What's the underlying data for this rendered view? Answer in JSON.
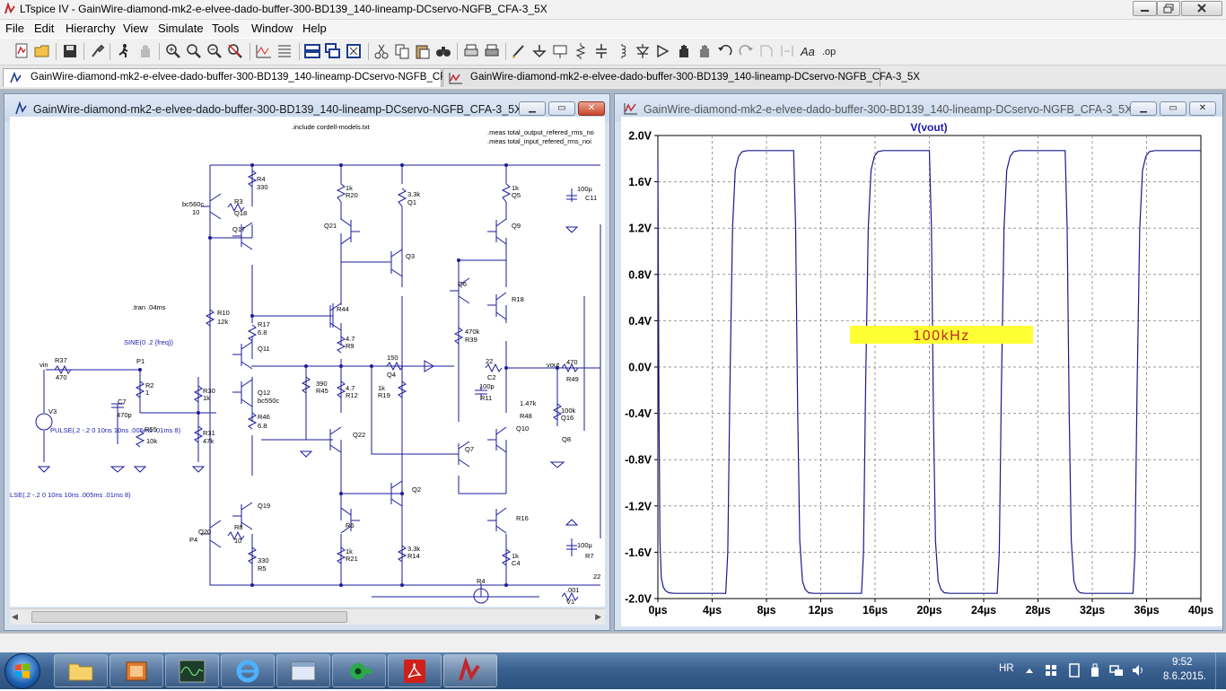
{
  "window": {
    "title": "LTspice IV - GainWire-diamond-mk2-e-elvee-dado-buffer-300-BD139_140-lineamp-DCservo-NGFB_CFA-3_5X"
  },
  "menu": [
    "File",
    "Edit",
    "Hierarchy",
    "View",
    "Simulate",
    "Tools",
    "Window",
    "Help"
  ],
  "tabs": [
    {
      "label": "GainWire-diamond-mk2-e-elvee-dado-buffer-300-BD139_140-lineamp-DCservo-NGFB_CFA-3_5X",
      "icon": "schematic-icon"
    },
    {
      "label": "GainWire-diamond-mk2-e-elvee-dado-buffer-300-BD139_140-lineamp-DCservo-NGFB_CFA-3_5X",
      "icon": "waveform-icon"
    }
  ],
  "schematic_window": {
    "title": "GainWire-diamond-mk2-e-elvee-dado-buffer-300-BD139_140-lineamp-DCservo-NGFB_CFA-3_5X",
    "directives": [
      ".include cordell-models.txt",
      ".meas total_output_refered_rms_no",
      ".meas total_input_refered_rms_noi",
      ".tran .04ms",
      "SINE(0 .2 {freq})",
      "PULSE(.2 -.2 0 10ns 10ns .005ms .01ms 8)",
      "LSE(.2 -.2 0 10ns 10ns .005ms .01ms 8)"
    ],
    "labels": [
      "vin",
      "vout",
      "P1",
      "V3",
      "R37",
      "470",
      "R2",
      "1",
      "C7",
      "470p",
      "R55",
      "10k",
      "R30",
      "1k",
      "R31",
      "47k",
      "R3",
      "10",
      "Q18",
      "bc560c",
      "Q17",
      "R4",
      "330",
      "R10",
      "12k",
      "R17",
      "6.8",
      "Q11",
      "Q12",
      "bc550c",
      "R46",
      "6.8",
      "Q19",
      "Q20",
      "R8",
      "10",
      "P4",
      "330",
      "R5",
      "1k",
      "R20",
      "3.3k",
      "Q1",
      "Q21",
      "Q3",
      "R44",
      "4.7",
      "R9",
      "390",
      "R45",
      "4.7",
      "R12",
      "1k",
      "R19",
      "150",
      "Q4",
      "Q22",
      "Q2",
      "R6",
      "1k",
      "R21",
      "3.3k",
      "R14",
      "1k",
      "Q5",
      "Q9",
      "Q6",
      "R18",
      "470k",
      "R39",
      "22",
      "C2",
      "100p",
      "R11",
      "1.47k",
      "R48",
      "100k",
      "Q16",
      "Q8",
      "Q10",
      "Q7",
      "R16",
      "1k",
      "C4",
      "100µ",
      "C11",
      "100µ",
      "R7",
      "470",
      "R49",
      ".001",
      "V1",
      "R4",
      "22"
    ]
  },
  "plot_window": {
    "title": "GainWire-diamond-mk2-e-elvee-dado-buffer-300-BD139_140-lineamp-DCservo-NGFB_CFA-3_5X",
    "annotation": "100kHz",
    "annotation_color": "#ffff33"
  },
  "chart_data": {
    "type": "line",
    "title": "V(vout)",
    "xlabel": "",
    "ylabel": "",
    "x_ticks": [
      "0µs",
      "4µs",
      "8µs",
      "12µs",
      "16µs",
      "20µs",
      "24µs",
      "28µs",
      "32µs",
      "36µs",
      "40µs"
    ],
    "y_ticks": [
      "2.0V",
      "1.6V",
      "1.2V",
      "0.8V",
      "0.4V",
      "0.0V",
      "-0.4V",
      "-0.8V",
      "-1.2V",
      "-1.6V",
      "-2.0V"
    ],
    "xlim": [
      0,
      40
    ],
    "ylim": [
      -2.0,
      2.0
    ],
    "grid": true,
    "series": [
      {
        "name": "V(vout)",
        "color": "#1a1a8c",
        "x": [
          0,
          0.08,
          0.15,
          0.25,
          0.4,
          0.55,
          0.8,
          1.2,
          2.0,
          3.0,
          4.0,
          5.0,
          5.15,
          5.3,
          5.5,
          5.7,
          5.95,
          6.2,
          6.6,
          7.0,
          9.0,
          10.0,
          10.15,
          10.3,
          10.45,
          10.65,
          10.85,
          11.1,
          11.5,
          12.0,
          14.0,
          15.0,
          15.15,
          15.3,
          15.5,
          15.7,
          15.95,
          16.2,
          16.6,
          17.0,
          19.0,
          20.0,
          20.15,
          20.3,
          20.45,
          20.65,
          20.85,
          21.1,
          21.5,
          22.0,
          24.0,
          25.0,
          25.15,
          25.3,
          25.5,
          25.7,
          25.95,
          26.2,
          26.6,
          27.0,
          29.0,
          30.0,
          30.15,
          30.3,
          30.45,
          30.65,
          30.85,
          31.1,
          31.5,
          32.0,
          34.0,
          35.0,
          35.15,
          35.3,
          35.5,
          35.7,
          35.95,
          36.2,
          36.6,
          37.0,
          39.0,
          40.0
        ],
        "y": [
          1.78,
          -0.3,
          -1.5,
          -1.82,
          -1.9,
          -1.93,
          -1.95,
          -1.955,
          -1.955,
          -1.955,
          -1.955,
          -1.955,
          -1.6,
          -0.2,
          1.2,
          1.7,
          1.82,
          1.86,
          1.87,
          1.87,
          1.87,
          1.87,
          1.2,
          -0.4,
          -1.5,
          -1.85,
          -1.92,
          -1.95,
          -1.955,
          -1.955,
          -1.955,
          -1.955,
          -1.6,
          -0.2,
          1.2,
          1.7,
          1.82,
          1.86,
          1.87,
          1.87,
          1.87,
          1.87,
          1.2,
          -0.4,
          -1.5,
          -1.85,
          -1.92,
          -1.95,
          -1.955,
          -1.955,
          -1.955,
          -1.955,
          -1.6,
          -0.2,
          1.2,
          1.7,
          1.82,
          1.86,
          1.87,
          1.87,
          1.87,
          1.87,
          1.2,
          -0.4,
          -1.5,
          -1.85,
          -1.92,
          -1.95,
          -1.955,
          -1.955,
          -1.955,
          -1.955,
          -1.6,
          -0.2,
          1.2,
          1.7,
          1.82,
          1.86,
          1.87,
          1.87,
          1.87,
          1.87
        ]
      }
    ]
  },
  "taskbar": {
    "language": "HR",
    "time": "9:52",
    "date": "8.6.2015."
  }
}
